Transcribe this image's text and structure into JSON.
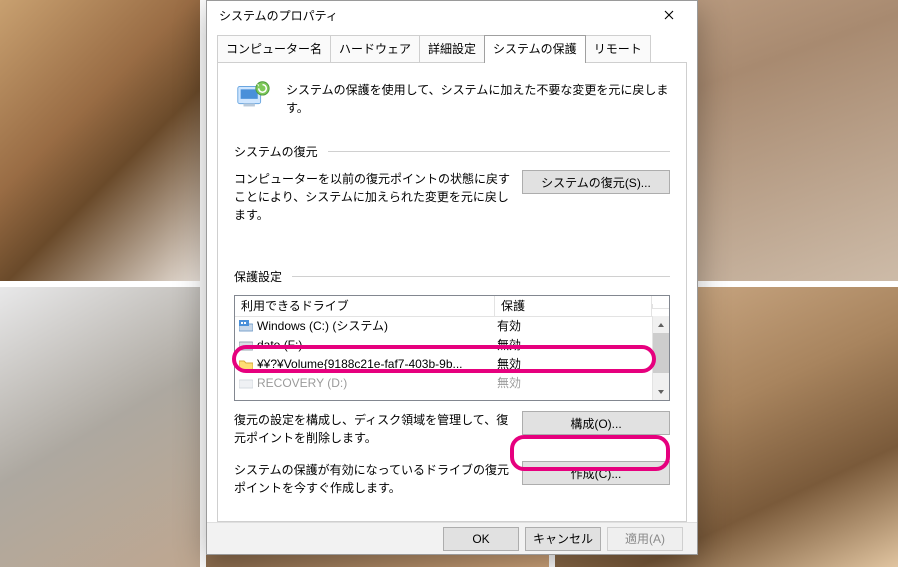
{
  "dialog": {
    "title": "システムのプロパティ"
  },
  "tabs": [
    {
      "label": "コンピューター名"
    },
    {
      "label": "ハードウェア"
    },
    {
      "label": "詳細設定"
    },
    {
      "label": "システムの保護",
      "active": true
    },
    {
      "label": "リモート"
    }
  ],
  "intro": "システムの保護を使用して、システムに加えた不要な変更を元に戻します。",
  "restore": {
    "heading": "システムの復元",
    "desc": "コンピューターを以前の復元ポイントの状態に戻すことにより、システムに加えられた変更を元に戻します。",
    "button": "システムの復元(S)..."
  },
  "protection": {
    "heading": "保護設定",
    "columns": {
      "drive": "利用できるドライブ",
      "status": "保護"
    },
    "drives": [
      {
        "name": "Windows (C:) (システム)",
        "status": "有効",
        "icon": "drive-os"
      },
      {
        "name": "date (F:)",
        "status": "無効",
        "icon": "drive"
      },
      {
        "name": "¥¥?¥Volume{9188c21e-faf7-403b-9b...",
        "status": "無効",
        "icon": "folder"
      },
      {
        "name": "RECOVERY (D:)",
        "status": "無効",
        "icon": "drive"
      }
    ],
    "configure": {
      "desc": "復元の設定を構成し、ディスク領域を管理して、復元ポイントを削除します。",
      "button": "構成(O)..."
    },
    "create": {
      "desc": "システムの保護が有効になっているドライブの復元ポイントを今すぐ作成します。",
      "button": "作成(C)..."
    }
  },
  "footer": {
    "ok": "OK",
    "cancel": "キャンセル",
    "apply": "適用(A)"
  }
}
